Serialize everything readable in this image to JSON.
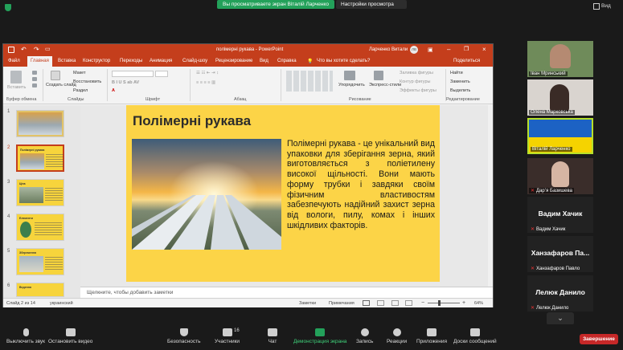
{
  "zoom_top": {
    "share_banner": "Вы просматриваете экран Віталій Ларченко",
    "view_settings": "Настройки просмотра",
    "view_button": "Вид"
  },
  "ppt": {
    "file_title": "полімерні рукава  -  PowerPoint",
    "user_name": "Ларченко Витали",
    "user_initials": "ЛВ",
    "menu": [
      "Файл",
      "Главная",
      "Вставка",
      "Конструктор",
      "Переходы",
      "Анимация",
      "Слайд-шоу",
      "Рецензирование",
      "Вид",
      "Справка"
    ],
    "tell_me": "Что вы хотите сделать?",
    "share": "Поделиться",
    "ribbon": {
      "paste": "Вставить",
      "new_slide": "Создать слайд",
      "layout": "Макет",
      "reset": "Восстановить",
      "section": "Раздел",
      "arrange": "Упорядочить",
      "quick_styles": "Экспресс-стили",
      "shape_fill": "Заливка фигуры",
      "shape_outline": "Контур фигуры",
      "shape_effects": "Эффекты фигуры",
      "find": "Найти",
      "replace": "Заменить",
      "select": "Выделить",
      "groups": [
        "Буфер обмена",
        "Слайды",
        "Шрифт",
        "Абзац",
        "Рисование",
        "Редактирование"
      ]
    },
    "thumbnails": [
      {
        "num": "1",
        "title": ""
      },
      {
        "num": "2",
        "title": "Полімерні рукава"
      },
      {
        "num": "3",
        "title": "Ціна"
      },
      {
        "num": "4",
        "title": "Елементи"
      },
      {
        "num": "5",
        "title": "Збереження"
      },
      {
        "num": "6",
        "title": "Ведення"
      }
    ],
    "slide": {
      "title": "Полімерні рукава",
      "body": "Полімерні рукава - це унікальний вид упаковки для зберігання зерна, який виготовляється з поліетилену високої щільності. Вони мають форму трубки і завдяки своїм фізичним властивостям забезпечують надійний захист зерна від вологи, пилу, комах і інших шкідливих факторів."
    },
    "notes_placeholder": "Щелкните, чтобы добавить заметки",
    "status": {
      "slide_of": "Слайд 2 из 14",
      "language": "украинский",
      "notes_btn": "Заметки",
      "comments_btn": "Примечания",
      "zoom": "64%"
    }
  },
  "participants": [
    {
      "name": "Іван Мринський",
      "type": "video"
    },
    {
      "name": "Олена Марковська",
      "type": "video"
    },
    {
      "name": "Віталій Ларченко",
      "type": "video"
    },
    {
      "name": "Дарʼя Базишева",
      "type": "video"
    },
    {
      "name": "Вадим Хачик",
      "label": "Вадим Хачик",
      "type": "name"
    },
    {
      "name": "Ханзафаров Павло",
      "label": "Ханзафаров Па...",
      "type": "name"
    },
    {
      "name": "Лелюк Данило",
      "label": "Лелюк Данило",
      "type": "name"
    }
  ],
  "toolbar": {
    "mute": "Выключить звук",
    "video": "Остановить видео",
    "security": "Безопасность",
    "participants": "Участники",
    "participants_count": "16",
    "chat": "Чат",
    "share": "Демонстрация экрана",
    "record": "Запись",
    "reactions": "Реакции",
    "apps": "Приложения",
    "whiteboards": "Доски сообщений",
    "end": "Завершение"
  }
}
